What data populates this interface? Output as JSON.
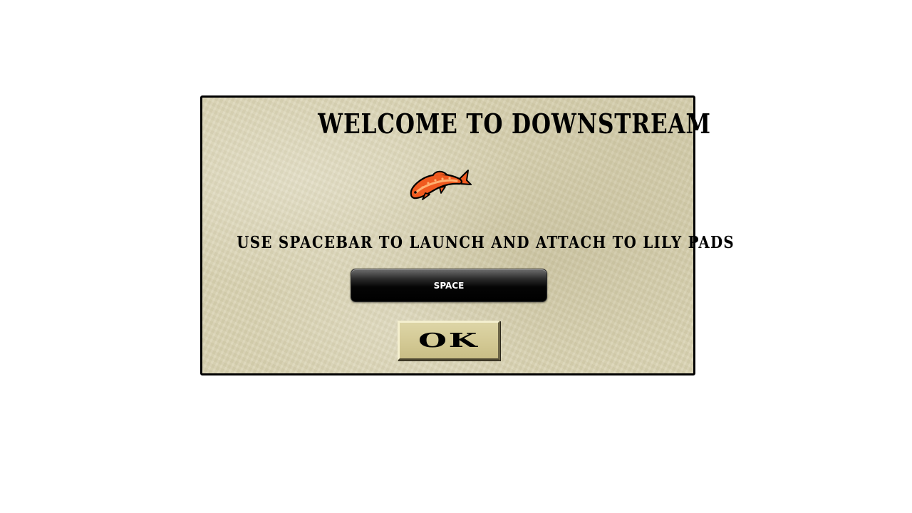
{
  "dialog": {
    "title": "WELCOME TO DOWNSTREAM",
    "icon": "koi-fish-icon",
    "instructions": "USE SPACEBAR TO LAUNCH AND ATTACH TO LILY PADS",
    "key_label": "SPACE",
    "ok_label": "OK"
  },
  "colors": {
    "parchment": "#d9d3b3",
    "border": "#000000",
    "fish_orange": "#f05a1f",
    "fish_light": "#ff8a3d",
    "key_black": "#000000",
    "button_tan": "#d4ca96"
  }
}
